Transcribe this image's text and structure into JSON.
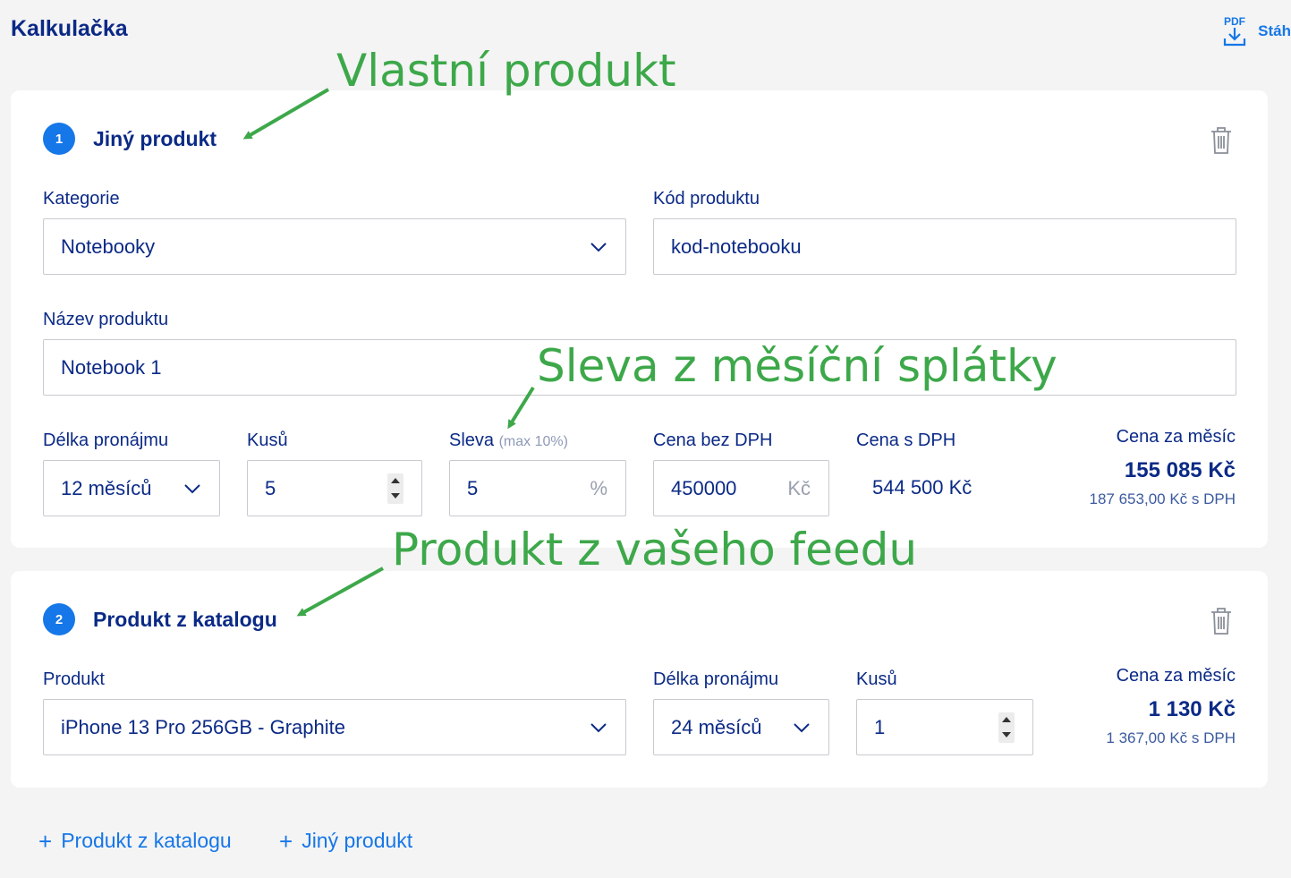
{
  "header": {
    "title": "Kalkulačka",
    "pdf_icon_text": "PDF",
    "pdf_label": "Stáh"
  },
  "products": [
    {
      "number": "1",
      "title": "Jiný produkt",
      "category": {
        "label": "Kategorie",
        "value": "Notebooky"
      },
      "code": {
        "label": "Kód produktu",
        "value": "kod-notebooku"
      },
      "name": {
        "label": "Název produktu",
        "value": "Notebook 1"
      },
      "rental": {
        "label": "Délka pronájmu",
        "value": "12 měsíců"
      },
      "quantity": {
        "label": "Kusů",
        "value": "5"
      },
      "discount": {
        "label": "Sleva",
        "hint": "(max 10%)",
        "value": "5",
        "suffix": "%"
      },
      "price_excl_vat": {
        "label": "Cena bez DPH",
        "value": "450000",
        "suffix": "Kč"
      },
      "price_incl_vat": {
        "label": "Cena s DPH",
        "value": "544 500 Kč"
      },
      "monthly": {
        "label": "Cena za měsíc",
        "value": "155 085 Kč",
        "with_vat": "187 653,00 Kč s DPH"
      }
    },
    {
      "number": "2",
      "title": "Produkt z katalogu",
      "product": {
        "label": "Produkt",
        "value": "iPhone 13 Pro 256GB - Graphite"
      },
      "rental": {
        "label": "Délka pronájmu",
        "value": "24 měsíců"
      },
      "quantity": {
        "label": "Kusů",
        "value": "1"
      },
      "monthly": {
        "label": "Cena za měsíc",
        "value": "1 130 Kč",
        "with_vat": "1 367,00 Kč s DPH"
      }
    }
  ],
  "actions": {
    "add_catalog": "Produkt z katalogu",
    "add_other": "Jiný produkt",
    "plus": "+"
  },
  "annotations": {
    "custom_product": "Vlastní produkt",
    "monthly_discount": "Sleva z měsíční splátky",
    "feed_product": "Produkt z vašeho feedu"
  },
  "colors": {
    "brand_blue": "#1677e8",
    "navy_text": "#0b2a86",
    "annotation_green": "#3da84a",
    "background": "#f4f4f4"
  }
}
